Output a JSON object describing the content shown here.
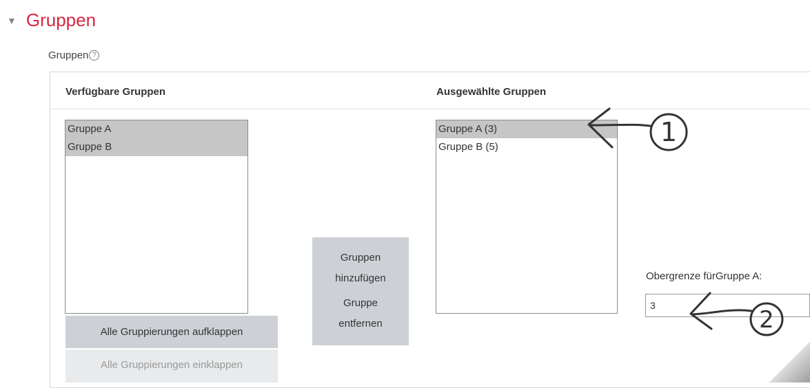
{
  "section": {
    "title": "Gruppen"
  },
  "field": {
    "label": "Gruppen",
    "help": "?"
  },
  "available": {
    "heading": "Verfügbare Gruppen",
    "items": [
      "Gruppe A",
      "Gruppe B"
    ]
  },
  "selected": {
    "heading": "Ausgewählte Gruppen",
    "items": [
      "Gruppe A (3)",
      "Gruppe B (5)"
    ]
  },
  "buttons": {
    "add_line1": "Gruppen",
    "add_line2": "hinzufügen",
    "remove_line1": "Gruppe",
    "remove_line2": "entfernen",
    "expand_all": "Alle Gruppierungen aufklappen",
    "collapse_all": "Alle Gruppierungen einklappen"
  },
  "limit": {
    "label": "Obergrenze fürGruppe A:",
    "value": "3"
  },
  "annotations": {
    "one": "1",
    "two": "2"
  }
}
